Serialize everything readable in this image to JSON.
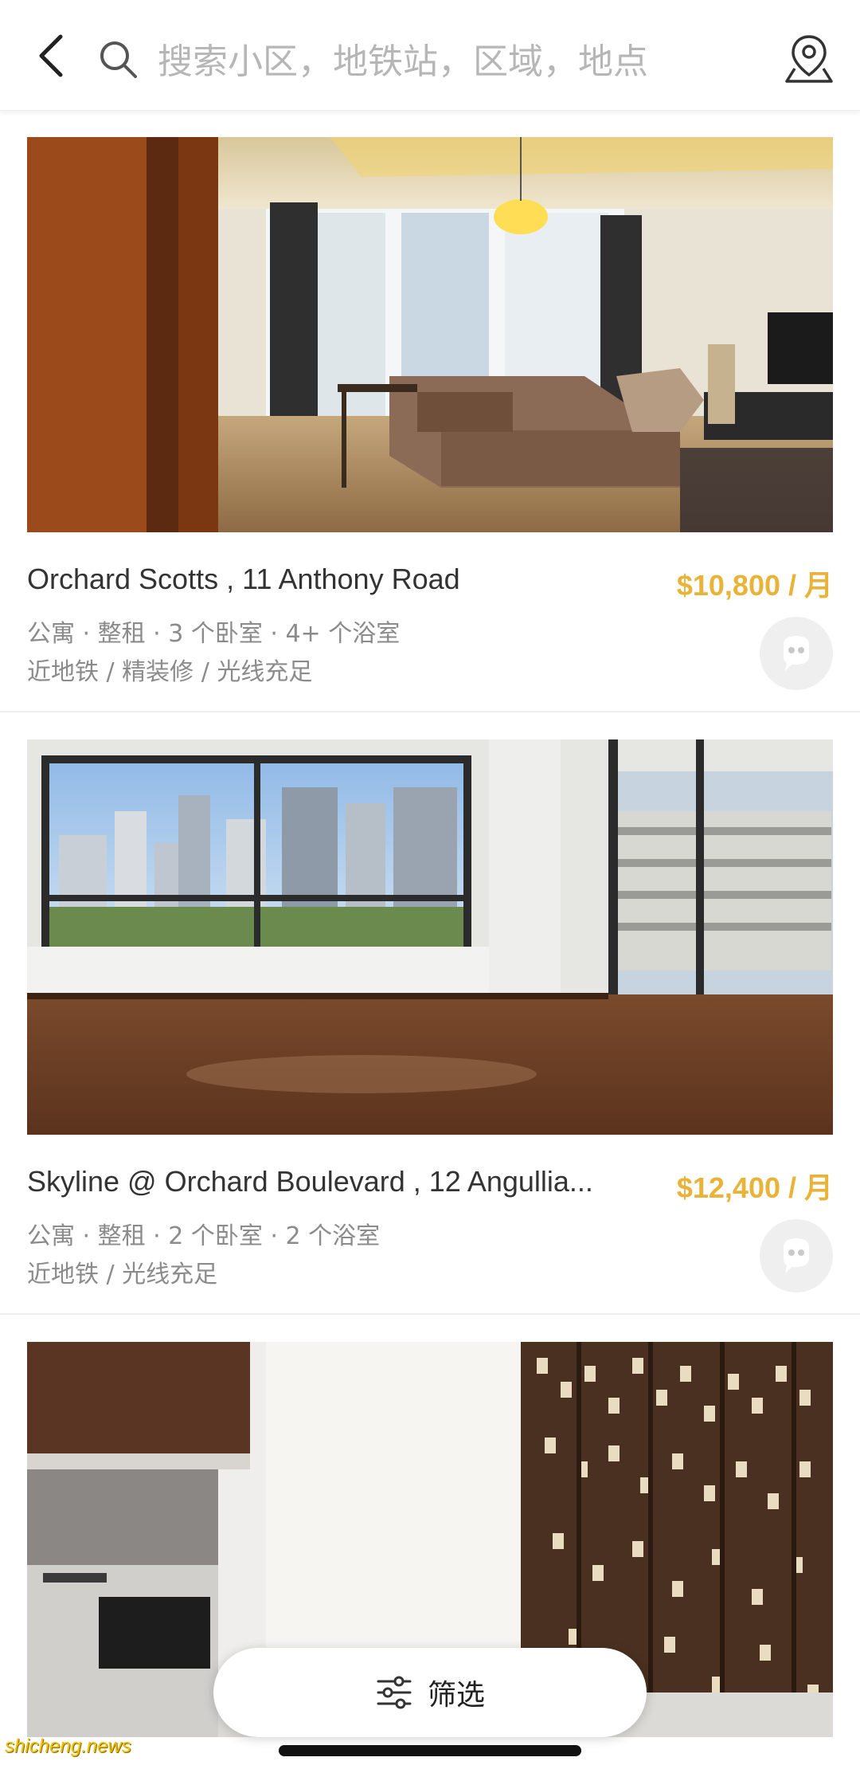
{
  "header": {
    "search_placeholder": "搜索小区，地铁站，区域，地点"
  },
  "listings": [
    {
      "title": "Orchard Scotts , 11 Anthony Road",
      "price": "$10,800 / 月",
      "details": "公寓 · 整租 · 3 个卧室 · 4+ 个浴室",
      "tags": "近地铁 / 精装修 / 光线充足"
    },
    {
      "title": "Skyline @ Orchard Boulevard , 12 Angullia...",
      "price": "$12,400 / 月",
      "details": "公寓 · 整租 · 2 个卧室 · 2 个浴室",
      "tags": "近地铁 / 光线充足"
    }
  ],
  "filter": {
    "label": "筛选"
  },
  "watermark": "shicheng.news",
  "colors": {
    "accent": "#e8b338",
    "muted": "#8b8b8b"
  }
}
